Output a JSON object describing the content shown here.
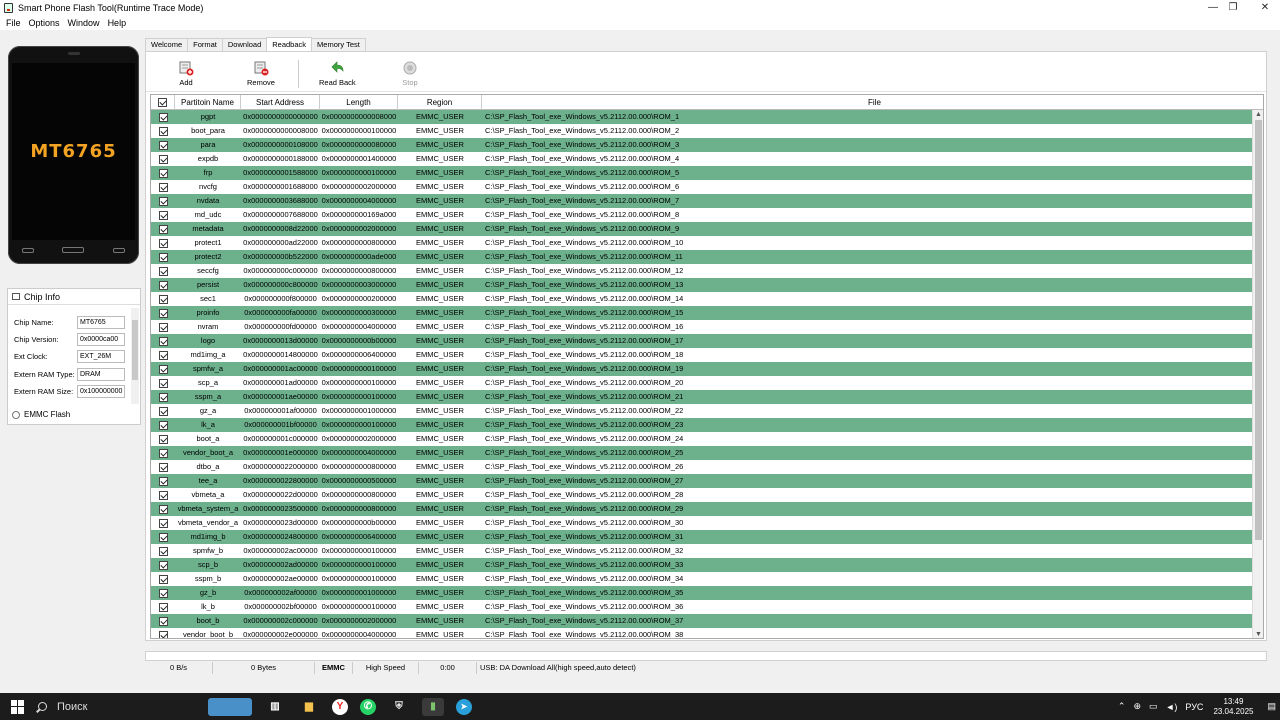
{
  "window": {
    "title": "Smart Phone Flash Tool(Runtime Trace Mode)",
    "controls": {
      "minimize": "—",
      "maximize": "❐",
      "close": "✕"
    }
  },
  "menu": [
    "File",
    "Options",
    "Window",
    "Help"
  ],
  "phone": {
    "chip_display": "MT6765"
  },
  "chip_info": {
    "header": "Chip Info",
    "fields": [
      {
        "label": "Chip Name:",
        "value": "MT6765"
      },
      {
        "label": "Chip Version:",
        "value": "0x0000ca00"
      },
      {
        "label": "Ext Clock:",
        "value": "EXT_26M"
      },
      {
        "label": "Extern RAM Type:",
        "value": "DRAM"
      },
      {
        "label": "Extern RAM Size:",
        "value": "0x100000000"
      }
    ],
    "emmc_label": "EMMC Flash"
  },
  "tabs": [
    {
      "label": "Welcome",
      "active": false
    },
    {
      "label": "Format",
      "active": false
    },
    {
      "label": "Download",
      "active": false
    },
    {
      "label": "Readback",
      "active": true
    },
    {
      "label": "Memory Test",
      "active": false
    }
  ],
  "toolbar": {
    "add_label": "Add",
    "remove_label": "Remove",
    "readback_label": "Read Back",
    "stop_label": "Stop"
  },
  "table": {
    "columns": [
      "Partitoin Name",
      "Start Address",
      "Length",
      "Region",
      "File"
    ],
    "rows": [
      [
        "pgpt",
        "0x0000000000000000",
        "0x0000000000008000",
        "EMMC_USER",
        "C:\\SP_Flash_Tool_exe_Windows_v5.2112.00.000\\ROM_1"
      ],
      [
        "boot_para",
        "0x0000000000008000",
        "0x0000000000100000",
        "EMMC_USER",
        "C:\\SP_Flash_Tool_exe_Windows_v5.2112.00.000\\ROM_2"
      ],
      [
        "para",
        "0x0000000000108000",
        "0x0000000000080000",
        "EMMC_USER",
        "C:\\SP_Flash_Tool_exe_Windows_v5.2112.00.000\\ROM_3"
      ],
      [
        "expdb",
        "0x0000000000188000",
        "0x0000000001400000",
        "EMMC_USER",
        "C:\\SP_Flash_Tool_exe_Windows_v5.2112.00.000\\ROM_4"
      ],
      [
        "frp",
        "0x0000000001588000",
        "0x0000000000100000",
        "EMMC_USER",
        "C:\\SP_Flash_Tool_exe_Windows_v5.2112.00.000\\ROM_5"
      ],
      [
        "nvcfg",
        "0x0000000001688000",
        "0x0000000002000000",
        "EMMC_USER",
        "C:\\SP_Flash_Tool_exe_Windows_v5.2112.00.000\\ROM_6"
      ],
      [
        "nvdata",
        "0x0000000003688000",
        "0x0000000004000000",
        "EMMC_USER",
        "C:\\SP_Flash_Tool_exe_Windows_v5.2112.00.000\\ROM_7"
      ],
      [
        "md_udc",
        "0x0000000007688000",
        "0x000000000169a000",
        "EMMC_USER",
        "C:\\SP_Flash_Tool_exe_Windows_v5.2112.00.000\\ROM_8"
      ],
      [
        "metadata",
        "0x0000000008d22000",
        "0x0000000002000000",
        "EMMC_USER",
        "C:\\SP_Flash_Tool_exe_Windows_v5.2112.00.000\\ROM_9"
      ],
      [
        "protect1",
        "0x000000000ad22000",
        "0x0000000000800000",
        "EMMC_USER",
        "C:\\SP_Flash_Tool_exe_Windows_v5.2112.00.000\\ROM_10"
      ],
      [
        "protect2",
        "0x000000000b522000",
        "0x0000000000ade000",
        "EMMC_USER",
        "C:\\SP_Flash_Tool_exe_Windows_v5.2112.00.000\\ROM_11"
      ],
      [
        "seccfg",
        "0x000000000c000000",
        "0x0000000000800000",
        "EMMC_USER",
        "C:\\SP_Flash_Tool_exe_Windows_v5.2112.00.000\\ROM_12"
      ],
      [
        "persist",
        "0x000000000c800000",
        "0x0000000003000000",
        "EMMC_USER",
        "C:\\SP_Flash_Tool_exe_Windows_v5.2112.00.000\\ROM_13"
      ],
      [
        "sec1",
        "0x000000000f800000",
        "0x0000000000200000",
        "EMMC_USER",
        "C:\\SP_Flash_Tool_exe_Windows_v5.2112.00.000\\ROM_14"
      ],
      [
        "proinfo",
        "0x000000000fa00000",
        "0x0000000000300000",
        "EMMC_USER",
        "C:\\SP_Flash_Tool_exe_Windows_v5.2112.00.000\\ROM_15"
      ],
      [
        "nvram",
        "0x000000000fd00000",
        "0x0000000004000000",
        "EMMC_USER",
        "C:\\SP_Flash_Tool_exe_Windows_v5.2112.00.000\\ROM_16"
      ],
      [
        "logo",
        "0x0000000013d00000",
        "0x0000000000b00000",
        "EMMC_USER",
        "C:\\SP_Flash_Tool_exe_Windows_v5.2112.00.000\\ROM_17"
      ],
      [
        "md1img_a",
        "0x0000000014800000",
        "0x0000000006400000",
        "EMMC_USER",
        "C:\\SP_Flash_Tool_exe_Windows_v5.2112.00.000\\ROM_18"
      ],
      [
        "spmfw_a",
        "0x000000001ac00000",
        "0x0000000000100000",
        "EMMC_USER",
        "C:\\SP_Flash_Tool_exe_Windows_v5.2112.00.000\\ROM_19"
      ],
      [
        "scp_a",
        "0x000000001ad00000",
        "0x0000000000100000",
        "EMMC_USER",
        "C:\\SP_Flash_Tool_exe_Windows_v5.2112.00.000\\ROM_20"
      ],
      [
        "sspm_a",
        "0x000000001ae00000",
        "0x0000000000100000",
        "EMMC_USER",
        "C:\\SP_Flash_Tool_exe_Windows_v5.2112.00.000\\ROM_21"
      ],
      [
        "gz_a",
        "0x000000001af00000",
        "0x0000000001000000",
        "EMMC_USER",
        "C:\\SP_Flash_Tool_exe_Windows_v5.2112.00.000\\ROM_22"
      ],
      [
        "lk_a",
        "0x000000001bf00000",
        "0x0000000000100000",
        "EMMC_USER",
        "C:\\SP_Flash_Tool_exe_Windows_v5.2112.00.000\\ROM_23"
      ],
      [
        "boot_a",
        "0x000000001c000000",
        "0x0000000002000000",
        "EMMC_USER",
        "C:\\SP_Flash_Tool_exe_Windows_v5.2112.00.000\\ROM_24"
      ],
      [
        "vendor_boot_a",
        "0x000000001e000000",
        "0x0000000004000000",
        "EMMC_USER",
        "C:\\SP_Flash_Tool_exe_Windows_v5.2112.00.000\\ROM_25"
      ],
      [
        "dtbo_a",
        "0x0000000022000000",
        "0x0000000000800000",
        "EMMC_USER",
        "C:\\SP_Flash_Tool_exe_Windows_v5.2112.00.000\\ROM_26"
      ],
      [
        "tee_a",
        "0x0000000022800000",
        "0x0000000000500000",
        "EMMC_USER",
        "C:\\SP_Flash_Tool_exe_Windows_v5.2112.00.000\\ROM_27"
      ],
      [
        "vbmeta_a",
        "0x0000000022d00000",
        "0x0000000000800000",
        "EMMC_USER",
        "C:\\SP_Flash_Tool_exe_Windows_v5.2112.00.000\\ROM_28"
      ],
      [
        "vbmeta_system_a",
        "0x0000000023500000",
        "0x0000000000800000",
        "EMMC_USER",
        "C:\\SP_Flash_Tool_exe_Windows_v5.2112.00.000\\ROM_29"
      ],
      [
        "vbmeta_vendor_a",
        "0x0000000023d00000",
        "0x0000000000b00000",
        "EMMC_USER",
        "C:\\SP_Flash_Tool_exe_Windows_v5.2112.00.000\\ROM_30"
      ],
      [
        "md1img_b",
        "0x0000000024800000",
        "0x0000000006400000",
        "EMMC_USER",
        "C:\\SP_Flash_Tool_exe_Windows_v5.2112.00.000\\ROM_31"
      ],
      [
        "spmfw_b",
        "0x000000002ac00000",
        "0x0000000000100000",
        "EMMC_USER",
        "C:\\SP_Flash_Tool_exe_Windows_v5.2112.00.000\\ROM_32"
      ],
      [
        "scp_b",
        "0x000000002ad00000",
        "0x0000000000100000",
        "EMMC_USER",
        "C:\\SP_Flash_Tool_exe_Windows_v5.2112.00.000\\ROM_33"
      ],
      [
        "sspm_b",
        "0x000000002ae00000",
        "0x0000000000100000",
        "EMMC_USER",
        "C:\\SP_Flash_Tool_exe_Windows_v5.2112.00.000\\ROM_34"
      ],
      [
        "gz_b",
        "0x000000002af00000",
        "0x0000000001000000",
        "EMMC_USER",
        "C:\\SP_Flash_Tool_exe_Windows_v5.2112.00.000\\ROM_35"
      ],
      [
        "lk_b",
        "0x000000002bf00000",
        "0x0000000000100000",
        "EMMC_USER",
        "C:\\SP_Flash_Tool_exe_Windows_v5.2112.00.000\\ROM_36"
      ],
      [
        "boot_b",
        "0x000000002c000000",
        "0x0000000002000000",
        "EMMC_USER",
        "C:\\SP_Flash_Tool_exe_Windows_v5.2112.00.000\\ROM_37"
      ],
      [
        "vendor_boot_b",
        "0x000000002e000000",
        "0x0000000004000000",
        "EMMC_USER",
        "C:\\SP_Flash_Tool_exe_Windows_v5.2112.00.000\\ROM_38"
      ]
    ]
  },
  "statusbar": {
    "speed": "0 B/s",
    "bytes": "0 Bytes",
    "storage": "EMMC",
    "mode": "High Speed",
    "time": "0:00",
    "message": "USB: DA Download All(high speed,auto detect)"
  },
  "taskbar": {
    "search_placeholder": "Поиск",
    "language": "РУС",
    "time": "13:49",
    "date": "23.04.2025"
  },
  "colors": {
    "row_green": "#6cb08c",
    "chip_text": "#f3a323"
  }
}
